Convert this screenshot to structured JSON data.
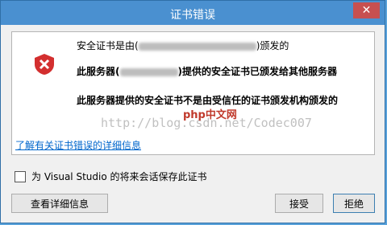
{
  "window": {
    "title": "证书错误",
    "close": "✕"
  },
  "content": {
    "line1_prefix": "安全证书是由(",
    "line1_suffix": ")颁发的",
    "line2_prefix": "此服务器(",
    "line2_suffix": ")提供的安全证书已颁发给其他服务器",
    "line3": "此服务器提供的安全证书不是由受信任的证书颁发机构颁发的",
    "link": "了解有关证书错误的详细信息",
    "watermark": "http://blog.csdn.net/Codec007",
    "watermark_logo": "php中文网"
  },
  "checkbox": {
    "label": "为 Visual Studio 的将来会话保存此证书",
    "checked": false
  },
  "buttons": {
    "details": "查看详细信息",
    "accept": "接受",
    "reject": "拒绝"
  },
  "colors": {
    "titlebar": "#4a90d0",
    "link": "#0066cc",
    "shield": "#d32f2f"
  }
}
